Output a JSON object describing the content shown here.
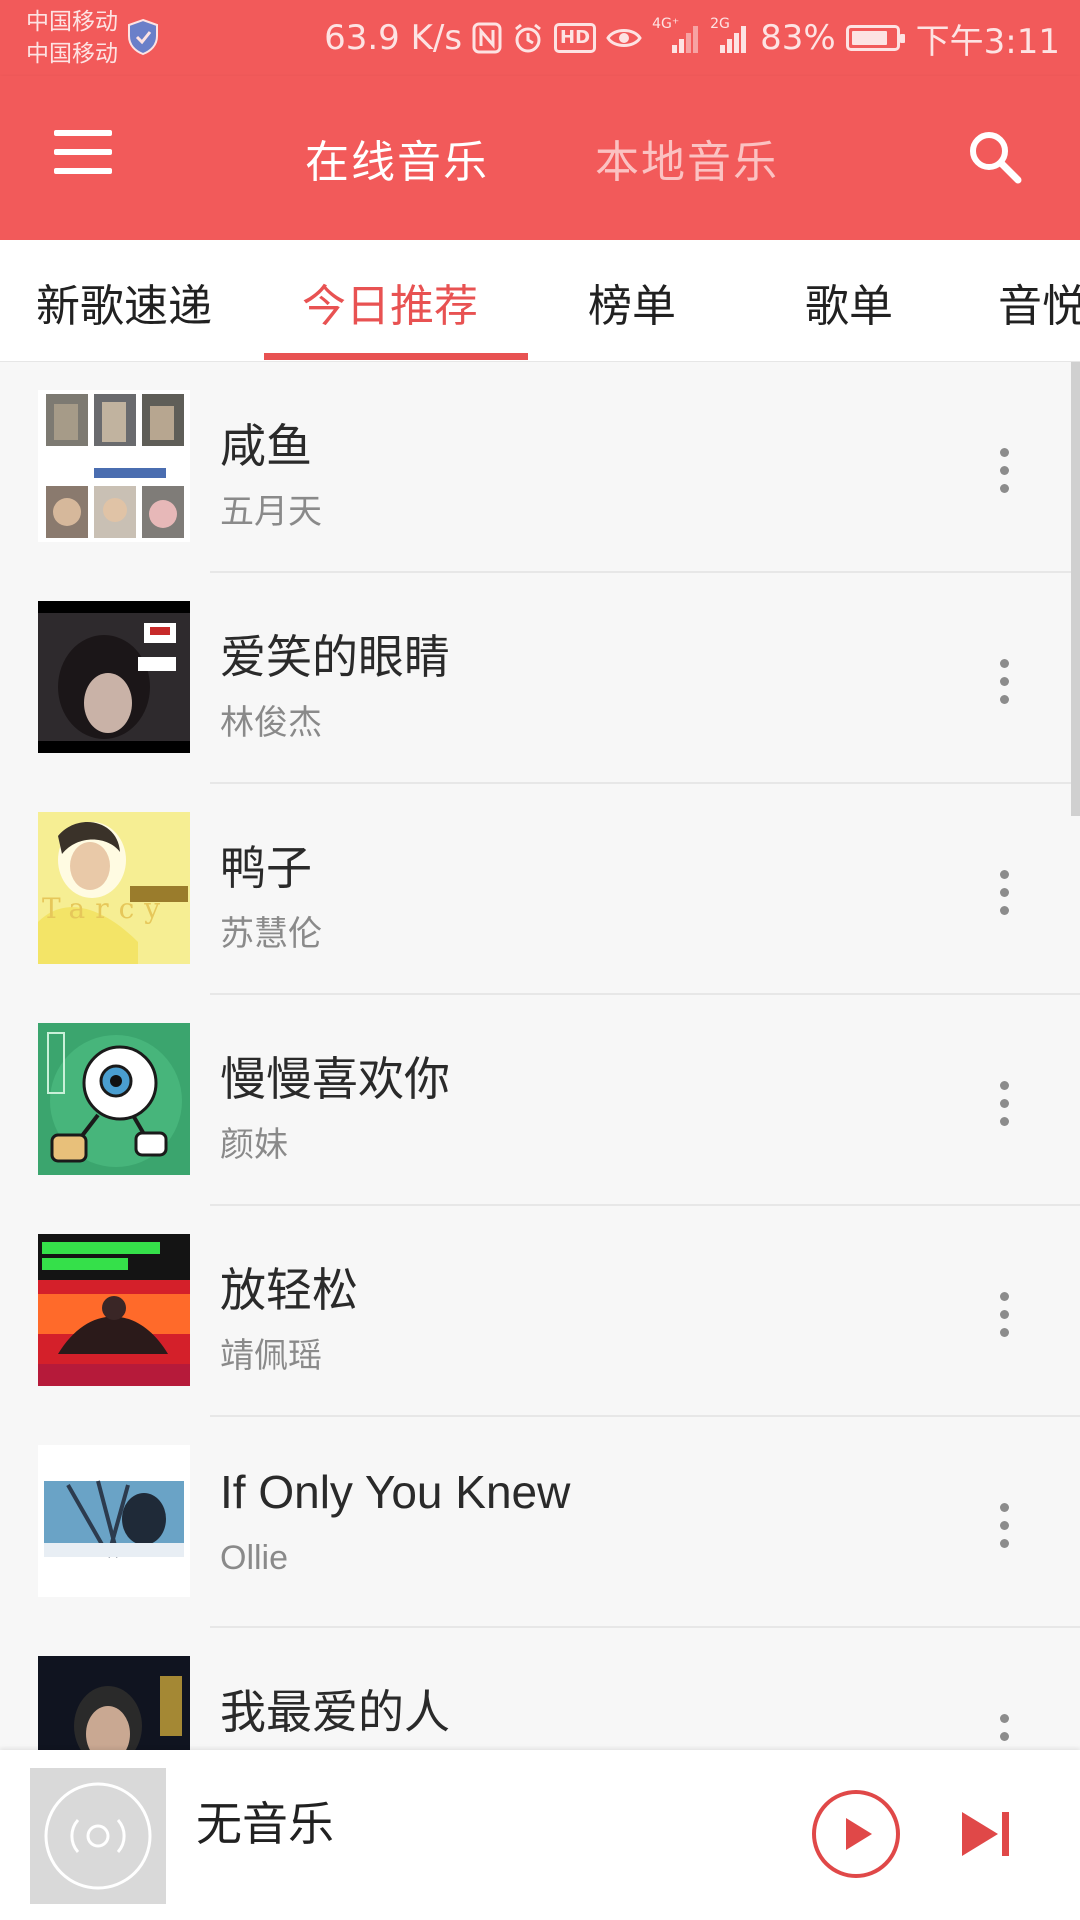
{
  "status_bar": {
    "carrier_1": "中国移动",
    "carrier_2": "中国移动",
    "speed": "63.9 K/s",
    "hd": "HD",
    "net_4g": "4G⁺",
    "net_2g": "2G",
    "battery": "83%",
    "battery_level": 0.83,
    "time": "下午3:11"
  },
  "app_bar": {
    "tab_online": "在线音乐",
    "tab_local": "本地音乐",
    "active_tab": "在线音乐"
  },
  "category_tabs": [
    "新歌速递",
    "今日推荐",
    "榜单",
    "歌单",
    "音悦"
  ],
  "active_category": "今日推荐",
  "songs": [
    {
      "title": "咸鱼",
      "artist": "五月天"
    },
    {
      "title": "爱笑的眼睛",
      "artist": "林俊杰"
    },
    {
      "title": "鸭子",
      "artist": "苏慧伦"
    },
    {
      "title": "慢慢喜欢你",
      "artist": "颜妹"
    },
    {
      "title": "放轻松",
      "artist": "靖佩瑶"
    },
    {
      "title": "If Only You Knew",
      "artist": "Ollie"
    },
    {
      "title": "我最爱的人",
      "artist": ""
    }
  ],
  "player": {
    "title": "无音乐"
  },
  "colors": {
    "brand": "#f25a5a",
    "accent": "#e85252"
  },
  "icons": {
    "menu": "menu-icon",
    "search": "search-icon",
    "more": "more-vertical-icon",
    "play": "play-icon",
    "next": "skip-next-icon",
    "disc": "disc-icon"
  }
}
